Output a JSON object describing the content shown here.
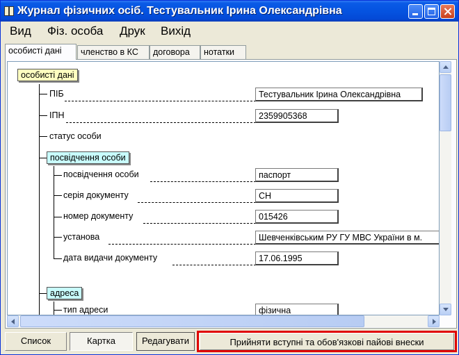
{
  "window": {
    "title": "Журнал фізичних осіб. Тестувальник Ірина Олександрівна"
  },
  "menu": [
    "Вид",
    "Фіз. особа",
    "Друк",
    "Вихід"
  ],
  "tabs": [
    "особисті дані",
    "членство в КС",
    "договора",
    "нотатки"
  ],
  "tree": {
    "root": "особисті дані",
    "pib_label": "ПІБ",
    "pib_value": "Тестувальник Ірина Олександрівна",
    "ipn_label": "ІПН",
    "ipn_value": "2359905368",
    "status_label": "статус особи",
    "id_group": "посвідчення особи",
    "doc_type_label": "посвідчення особи",
    "doc_type_value": "паспорт",
    "series_label": "серія документу",
    "series_value": "СН",
    "number_label": "номер документу",
    "number_value": "015426",
    "issuer_label": "установа",
    "issuer_value": "Шевченківським РУ ГУ МВС України в м.",
    "issue_date_label": "дата видачи документу",
    "issue_date_value": "17.06.1995",
    "address_group": "адреса",
    "address_type_label": "тип адреси",
    "address_type_value": "фізична"
  },
  "buttons": {
    "list": "Список",
    "card": "Картка",
    "edit": "Редагувати",
    "accept": "Прийняти вступні та обов'язкові пайові внески"
  }
}
